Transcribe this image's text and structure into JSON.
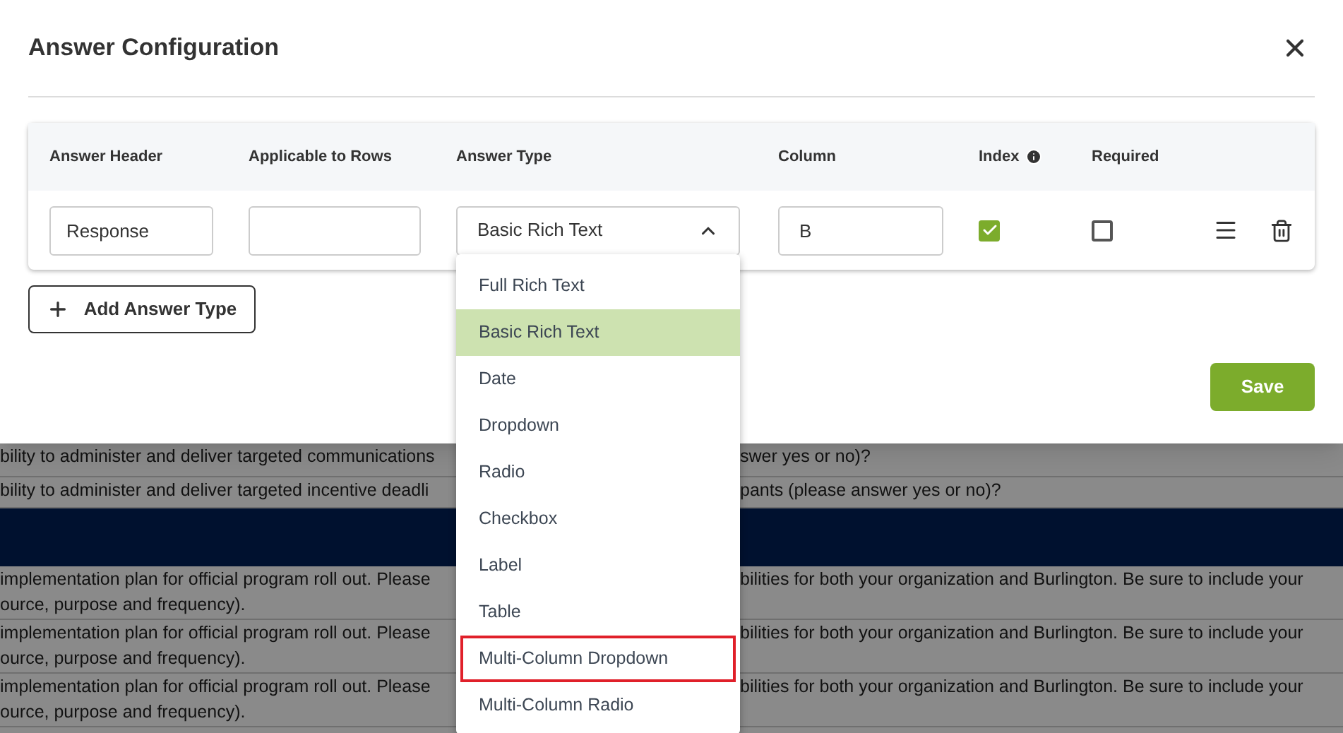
{
  "dialog": {
    "title": "Answer Configuration"
  },
  "table": {
    "columns": [
      "Answer Header",
      "Applicable to Rows",
      "Answer Type",
      "Column",
      "Index",
      "Required"
    ],
    "row": {
      "answer_header": "Response",
      "answer_type": "Basic Rich Text",
      "column": "B",
      "index_checked": true,
      "required_checked": false
    }
  },
  "dropdown": {
    "expanded": true,
    "options": [
      {
        "label": "Full Rich Text",
        "selected": false,
        "outlined": false
      },
      {
        "label": "Basic Rich Text",
        "selected": true,
        "outlined": false
      },
      {
        "label": "Date",
        "selected": false,
        "outlined": false
      },
      {
        "label": "Dropdown",
        "selected": false,
        "outlined": false
      },
      {
        "label": "Radio",
        "selected": false,
        "outlined": false
      },
      {
        "label": "Checkbox",
        "selected": false,
        "outlined": false
      },
      {
        "label": "Label",
        "selected": false,
        "outlined": false
      },
      {
        "label": "Table",
        "selected": false,
        "outlined": false
      },
      {
        "label": "Multi-Column Dropdown",
        "selected": false,
        "outlined": true
      },
      {
        "label": "Multi-Column Radio",
        "selected": false,
        "outlined": false
      }
    ]
  },
  "add_button": "Add Answer Type",
  "save_button": "Save",
  "background_rows": [
    {
      "kind": "text",
      "left": [
        "bility to administer and deliver targeted communications"
      ],
      "right": [
        "swer yes or no)?"
      ]
    },
    {
      "kind": "text",
      "left": [
        "bility to administer and deliver targeted incentive deadli"
      ],
      "right": [
        "pants (please answer yes or no)?"
      ]
    },
    {
      "kind": "band",
      "left": [],
      "right": []
    },
    {
      "kind": "text",
      "left": [
        "implementation plan for official program roll out. Please",
        "ource, purpose and frequency)."
      ],
      "right": [
        "bilities for both your organization and Burlington. Be sure to include your"
      ]
    },
    {
      "kind": "text",
      "left": [
        "implementation plan for official program roll out. Please",
        "ource, purpose and frequency)."
      ],
      "right": [
        "bilities for both your organization and Burlington. Be sure to include your"
      ]
    },
    {
      "kind": "text",
      "left": [
        "implementation plan for official program roll out. Please",
        "ource, purpose and frequency)."
      ],
      "right": [
        "bilities for both your organization and Burlington. Be sure to include your"
      ]
    }
  ]
}
